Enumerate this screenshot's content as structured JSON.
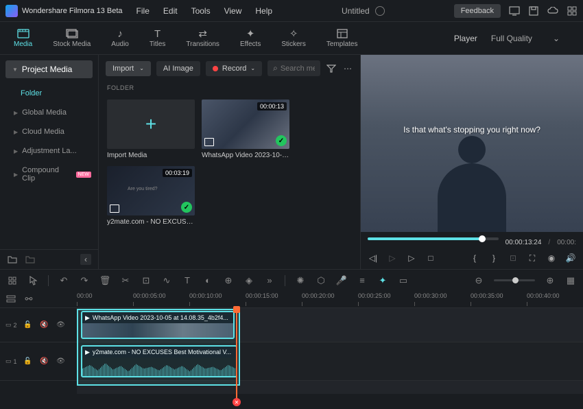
{
  "app": {
    "name": "Wondershare Filmora 13 Beta"
  },
  "menu": {
    "file": "File",
    "edit": "Edit",
    "tools": "Tools",
    "view": "View",
    "help": "Help"
  },
  "document": {
    "title": "Untitled"
  },
  "feedback": {
    "label": "Feedback"
  },
  "tabs": {
    "media": "Media",
    "stock": "Stock Media",
    "audio": "Audio",
    "titles": "Titles",
    "transitions": "Transitions",
    "effects": "Effects",
    "stickers": "Stickers",
    "templates": "Templates"
  },
  "player": {
    "label": "Player",
    "quality": "Full Quality",
    "caption": "Is that what's stopping you right now?",
    "current_time": "00:00:13:24",
    "total_time": "00:00:"
  },
  "sidebar": {
    "project_media": "Project Media",
    "folder": "Folder",
    "items": [
      "Global Media",
      "Cloud Media",
      "Adjustment La...",
      "Compound Clip"
    ]
  },
  "media_toolbar": {
    "import": "Import",
    "ai_image": "AI Image",
    "record": "Record",
    "search_placeholder": "Search me..."
  },
  "folder_section": "FOLDER",
  "media": {
    "import_label": "Import Media",
    "items": [
      {
        "name": "WhatsApp Video 2023-10-05...",
        "duration": "00:00:13"
      },
      {
        "name": "y2mate.com - NO EXCUSES ...",
        "duration": "00:03:19"
      }
    ]
  },
  "timeline": {
    "ticks": [
      "00:00",
      "00:00:05:00",
      "00:00:10:00",
      "00:00:15:00",
      "00:00:20:00",
      "00:00:25:00",
      "00:00:30:00",
      "00:00:35:00",
      "00:00:40:00"
    ],
    "tracks": [
      {
        "num": "2",
        "clip": "WhatsApp Video 2023-10-05 at 14.08.35_4b2f4..."
      },
      {
        "num": "1",
        "clip": "y2mate.com - NO EXCUSES  Best Motivational V..."
      }
    ]
  }
}
